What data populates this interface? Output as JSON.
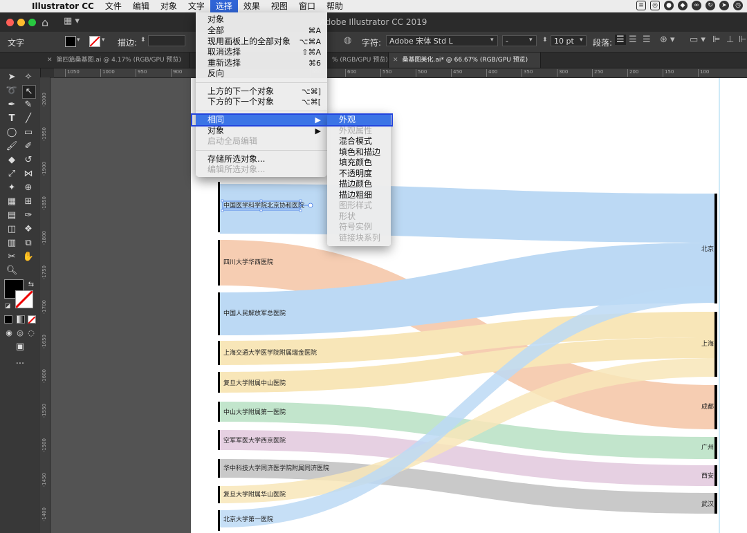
{
  "menubar": {
    "apple": "",
    "app": "Illustrator CC",
    "items": [
      "文件",
      "编辑",
      "对象",
      "文字",
      "选择",
      "效果",
      "视图",
      "窗口",
      "帮助"
    ],
    "active": "选择"
  },
  "titlebar": {
    "title": "Adobe Illustrator CC 2019"
  },
  "controlbar": {
    "tool_label": "文字",
    "stroke_label": "描边:",
    "char_label": "字符:",
    "font_family": "Adobe 宋体 Std L",
    "font_style": "-",
    "font_size": "10 pt",
    "para_label": "段落:"
  },
  "tabs": [
    {
      "label": "第四篇桑基图.ai @ 4.17% (RGB/GPU 预览)",
      "active": false
    },
    {
      "label": "% (RGB/GPU 预览)",
      "active": false
    },
    {
      "label": "桑基图美化.ai* @ 66.67% (RGB/GPU 预览)",
      "active": true
    }
  ],
  "ruler": {
    "top": [
      "1050",
      "1000",
      "950",
      "900",
      "650",
      "600",
      "550",
      "500",
      "450",
      "400",
      "350",
      "300",
      "250",
      "200",
      "150",
      "100"
    ],
    "left": [
      "-2000",
      "-1950",
      "-1900",
      "-1850",
      "-1800",
      "-1750",
      "-1700",
      "-1650",
      "-1600",
      "-1550",
      "-1500",
      "-1450",
      "-1400"
    ]
  },
  "select_menu": {
    "items": [
      {
        "label": "对象",
        "shortcut": "",
        "disabled": false
      },
      {
        "label": "全部",
        "shortcut": "⌘A",
        "disabled": false
      },
      {
        "label": "现用画板上的全部对象",
        "shortcut": "⌥⌘A",
        "disabled": false
      },
      {
        "label": "取消选择",
        "shortcut": "⇧⌘A",
        "disabled": false
      },
      {
        "label": "重新选择",
        "shortcut": "⌘6",
        "disabled": false
      },
      {
        "label": "反向",
        "shortcut": "",
        "disabled": false
      },
      {
        "label": "上方的下一个对象",
        "shortcut": "⌥⌘]",
        "disabled": false
      },
      {
        "label": "下方的下一个对象",
        "shortcut": "⌥⌘[",
        "disabled": false
      },
      {
        "label": "相同",
        "shortcut": "▶",
        "disabled": false,
        "highlighted": true
      },
      {
        "label": "对象",
        "shortcut": "▶",
        "disabled": false
      },
      {
        "label": "启动全局编辑",
        "shortcut": "",
        "disabled": true
      },
      {
        "label": "存储所选对象...",
        "shortcut": "",
        "disabled": false
      },
      {
        "label": "编辑所选对象...",
        "shortcut": "",
        "disabled": true
      }
    ]
  },
  "same_submenu": {
    "items": [
      {
        "label": "外观",
        "disabled": false,
        "highlighted": true
      },
      {
        "label": "外观属性",
        "disabled": true
      },
      {
        "label": "混合模式",
        "disabled": false
      },
      {
        "label": "填色和描边",
        "disabled": false
      },
      {
        "label": "填充颜色",
        "disabled": false
      },
      {
        "label": "不透明度",
        "disabled": false
      },
      {
        "label": "描边颜色",
        "disabled": false
      },
      {
        "label": "描边粗细",
        "disabled": false
      },
      {
        "label": "图形样式",
        "disabled": true
      },
      {
        "label": "形状",
        "disabled": true
      },
      {
        "label": "符号实例",
        "disabled": true
      },
      {
        "label": "链接块系列",
        "disabled": true
      }
    ]
  },
  "sankey": {
    "sources": [
      "中国医学科学院北京协和医院",
      "四川大学华西医院",
      "中国人民解放军总医院",
      "上海交通大学医学院附属瑞金医院",
      "复旦大学附属中山医院",
      "中山大学附属第一医院",
      "空军军医大学西京医院",
      "华中科技大学同济医学院附属同济医院",
      "复旦大学附属华山医院",
      "北京大学第一医院"
    ],
    "targets": [
      "北京",
      "上海",
      "成都",
      "广州",
      "西安",
      "武汉"
    ],
    "colors": {
      "blue": "#bcd9f4",
      "orange": "#f6cdb2",
      "yellow": "#f8e6b8",
      "green": "#c2e5cc",
      "pink": "#e6d0e2",
      "gray": "#c9c9c9"
    }
  }
}
